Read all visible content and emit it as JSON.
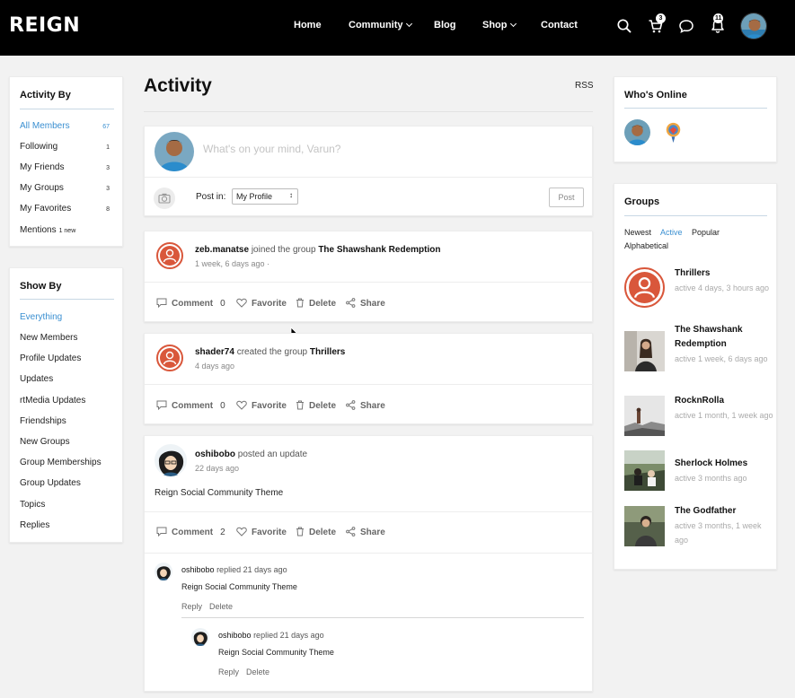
{
  "header": {
    "logo": "REIGN",
    "nav": [
      "Home",
      "Community",
      "Blog",
      "Shop",
      "Contact"
    ],
    "cart_count": "3",
    "notification_count": "11",
    "icons": [
      "search-icon",
      "cart-icon",
      "message-icon",
      "bell-icon"
    ]
  },
  "activity_by": {
    "title": "Activity By",
    "items": [
      {
        "label": "All Members",
        "count": "67"
      },
      {
        "label": "Following",
        "count": "1"
      },
      {
        "label": "My Friends",
        "count": "3"
      },
      {
        "label": "My Groups",
        "count": "3"
      },
      {
        "label": "My Favorites",
        "count": "8"
      },
      {
        "label": "Mentions",
        "count": "1 new"
      }
    ]
  },
  "show_by": {
    "title": "Show By",
    "items": [
      "Everything",
      "New Members",
      "Profile Updates",
      "Updates",
      "rtMedia Updates",
      "Friendships",
      "New Groups",
      "Group Memberships",
      "Group Updates",
      "Topics",
      "Replies"
    ]
  },
  "main": {
    "title": "Activity",
    "rss": "RSS",
    "composer": {
      "placeholder": "What's on your mind, Varun?",
      "post_in_label": "Post in:",
      "post_in_value": "My Profile",
      "post_button": "Post"
    },
    "activities": [
      {
        "user": "zeb.manatse",
        "action": "joined the group",
        "target": "The Shawshank Redemption",
        "time": "1 week, 6 days ago ·",
        "comment_count": "0"
      },
      {
        "user": "shader74",
        "action": "created the group",
        "target": "Thrillers",
        "time": "4 days ago",
        "comment_count": "0"
      },
      {
        "user": "oshibobo",
        "action": "posted an update",
        "time": "22 days ago",
        "content": "Reign Social Community Theme",
        "comment_count": "2",
        "replies": [
          {
            "user": "oshibobo",
            "meta": "replied 21 days ago",
            "text": "Reign Social Community Theme",
            "reply": "Reply",
            "delete": "Delete"
          },
          {
            "user": "oshibobo",
            "meta": "replied 21 days ago",
            "text": "Reign Social Community Theme",
            "reply": "Reply",
            "delete": "Delete"
          }
        ]
      }
    ],
    "actions": {
      "comment": "Comment",
      "favorite": "Favorite",
      "delete": "Delete",
      "share": "Share"
    }
  },
  "whos_online": {
    "title": "Who's Online"
  },
  "groups": {
    "title": "Groups",
    "tabs": [
      "Newest",
      "Active",
      "Popular",
      "Alphabetical"
    ],
    "active_tab": "Active",
    "items": [
      {
        "name": "Thrillers",
        "meta": "active 4 days, 3 hours ago"
      },
      {
        "name": "The Shawshank Redemption",
        "meta": "active 1 week, 6 days ago"
      },
      {
        "name": "RocknRolla",
        "meta": "active 1 month, 1 week ago"
      },
      {
        "name": "Sherlock Holmes",
        "meta": "active 3 months ago"
      },
      {
        "name": "The Godfather",
        "meta": "active 3 months, 1 week ago"
      }
    ]
  },
  "colors": {
    "accent": "#3a8fd1",
    "group_icon": "#d9573b",
    "header_bg": "#000000"
  }
}
